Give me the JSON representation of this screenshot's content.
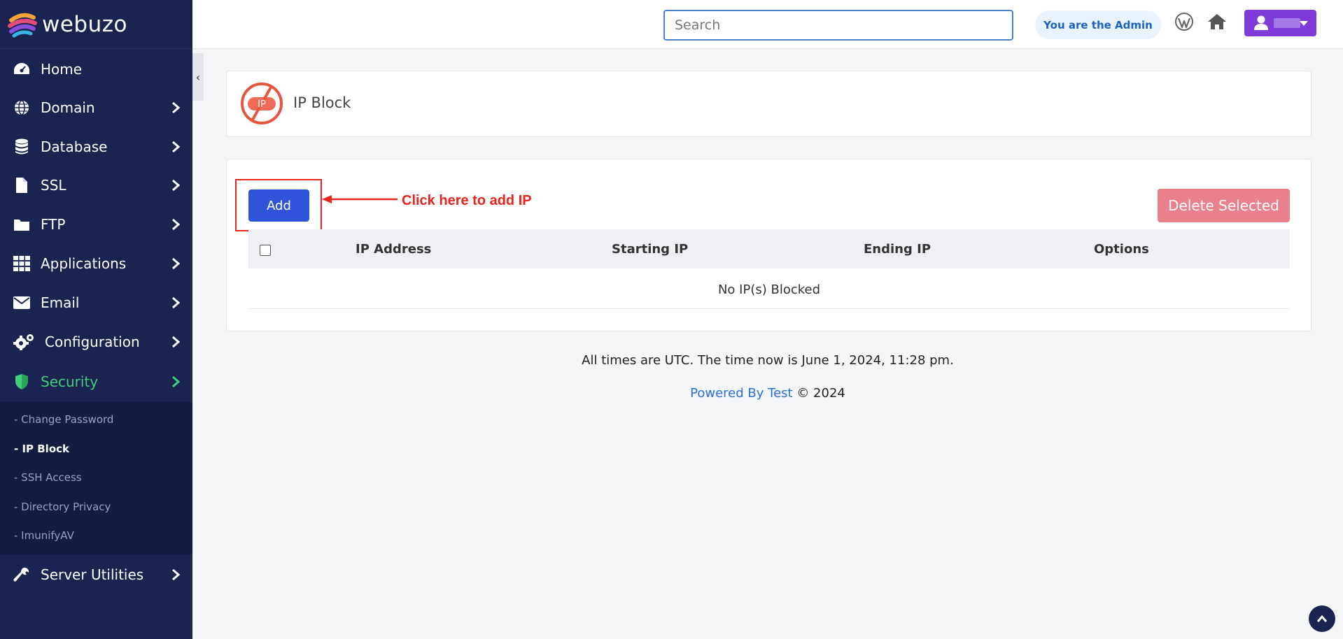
{
  "app": {
    "name": "webuzo"
  },
  "sidebar": {
    "items": [
      {
        "label": "Home",
        "icon": "dashboard-icon"
      },
      {
        "label": "Domain",
        "icon": "globe-icon"
      },
      {
        "label": "Database",
        "icon": "database-icon"
      },
      {
        "label": "SSL",
        "icon": "file-icon"
      },
      {
        "label": "FTP",
        "icon": "folder-icon"
      },
      {
        "label": "Applications",
        "icon": "grid-icon"
      },
      {
        "label": "Email",
        "icon": "envelope-icon"
      },
      {
        "label": "Configuration",
        "icon": "gears-icon"
      },
      {
        "label": "Security",
        "icon": "shield-icon"
      },
      {
        "label": "Server Utilities",
        "icon": "wrench-icon"
      }
    ],
    "security_subitems": [
      {
        "label": "- Change Password"
      },
      {
        "label": "- IP Block"
      },
      {
        "label": "- SSH Access"
      },
      {
        "label": "- Directory Privacy"
      },
      {
        "label": "- ImunifyAV"
      }
    ],
    "collapse_glyph": "‹",
    "active_color": "#3fcf7a"
  },
  "topbar": {
    "search_placeholder": "Search",
    "admin_label": "You are the Admin",
    "user_button_color": "#7e3bd8"
  },
  "page": {
    "title": "IP Block",
    "title_icon_text": "IP",
    "add_label": "Add",
    "delete_label": "Delete Selected",
    "annotation": "Click here to add IP",
    "table": {
      "columns": [
        "IP Address",
        "Starting IP",
        "Ending IP",
        "Options"
      ],
      "empty_message": "No IP(s) Blocked"
    }
  },
  "footer": {
    "time_note": "All times are UTC. The time now is June 1, 2024, 11:28 pm.",
    "powered_link": "Powered By Test",
    "copyright": "© 2024"
  },
  "colors": {
    "sidebar_bg": "#1b2351",
    "add_button": "#2f53d9",
    "delete_button": "#e9808b",
    "annotation": "#e8261d"
  }
}
